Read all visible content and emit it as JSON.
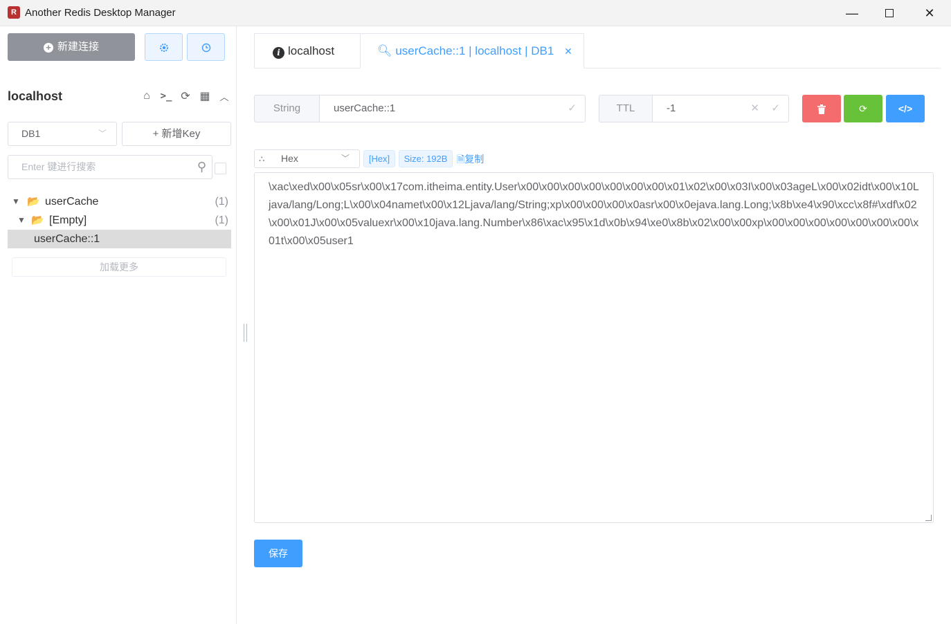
{
  "window": {
    "title": "Another Redis Desktop Manager",
    "minimize": "—",
    "close": "✕"
  },
  "sidebar": {
    "new_connection": "新建连接",
    "connection_name": "localhost",
    "db_select": "DB1",
    "new_key": "+ 新增Key",
    "search_placeholder": "Enter 键进行搜索",
    "tree": [
      {
        "label": "userCache",
        "count": "(1)"
      },
      {
        "label": "[Empty]",
        "count": "(1)"
      },
      {
        "label": "userCache::1"
      }
    ],
    "load_more": "加载更多"
  },
  "tabs": [
    {
      "label": "localhost",
      "icon": "info-icon"
    },
    {
      "label": "userCache::1 | localhost | DB1",
      "icon": "key-icon",
      "active": true
    }
  ],
  "key_detail": {
    "type": "String",
    "key_name": "userCache::1",
    "ttl_label": "TTL",
    "ttl_value": "-1",
    "format": "Hex",
    "format_tag": "[Hex]",
    "size_tag": "Size: 192B",
    "copy": "复制",
    "value": "\\xac\\xed\\x00\\x05sr\\x00\\x17com.itheima.entity.User\\x00\\x00\\x00\\x00\\x00\\x00\\x00\\x01\\x02\\x00\\x03I\\x00\\x03ageL\\x00\\x02idt\\x00\\x10Ljava/lang/Long;L\\x00\\x04namet\\x00\\x12Ljava/lang/String;xp\\x00\\x00\\x00\\x0asr\\x00\\x0ejava.lang.Long;\\x8b\\xe4\\x90\\xcc\\x8f#\\xdf\\x02\\x00\\x01J\\x00\\x05valuexr\\x00\\x10java.lang.Number\\x86\\xac\\x95\\x1d\\x0b\\x94\\xe0\\x8b\\x02\\x00\\x00xp\\x00\\x00\\x00\\x00\\x00\\x00\\x00\\x01t\\x00\\x05user1",
    "save": "保存"
  },
  "colors": {
    "primary": "#409eff",
    "danger": "#f56c6c",
    "success": "#67c23a",
    "grey_button": "#909399"
  }
}
